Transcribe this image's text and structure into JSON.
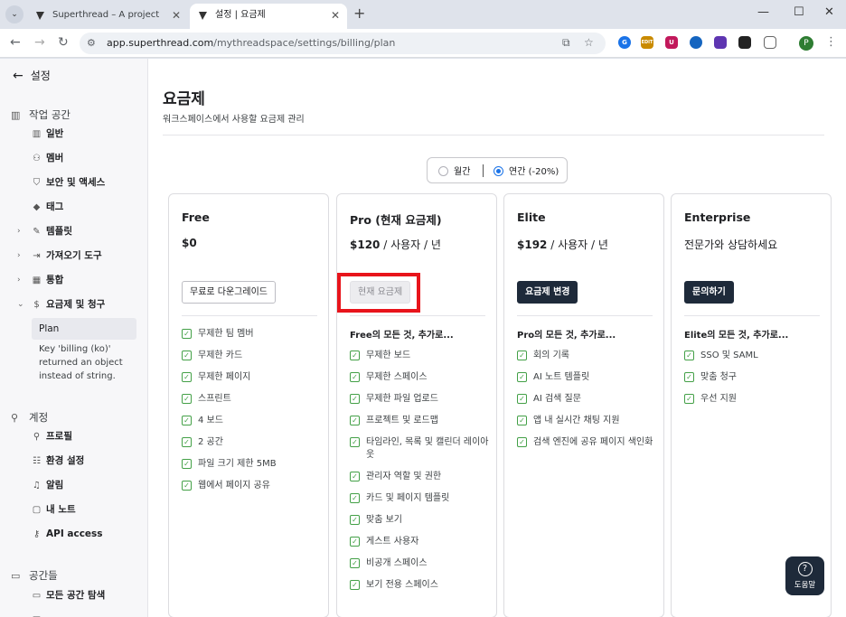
{
  "browser": {
    "tabs": [
      {
        "title": "Superthread – A project mana",
        "active": false
      },
      {
        "title": "설정 | 요금제",
        "active": true
      }
    ],
    "new_tab": "+",
    "url_host": "app.superthread.com",
    "url_path": "/mythreadspace/settings/billing/plan",
    "profile_initial": "P",
    "extensions": [
      {
        "icon": "ext-blue-icon",
        "color": "#1a73e8",
        "label": "G"
      },
      {
        "icon": "ext-orange-icon",
        "color": "#c98a00",
        "label": "EDIT"
      },
      {
        "icon": "ext-ublock-icon",
        "color": "#c2185b",
        "label": "U"
      },
      {
        "icon": "ext-shield-icon",
        "color": "#1565c0",
        "label": ""
      },
      {
        "icon": "ext-purple-icon",
        "color": "#5e35b1",
        "label": ""
      },
      {
        "icon": "ext-dark-icon",
        "color": "#222222",
        "label": ""
      }
    ]
  },
  "sidebar": {
    "back_label": "설정",
    "workspace": {
      "title": "작업 공간",
      "items": [
        {
          "label": "일반",
          "icon": "building-icon"
        },
        {
          "label": "멤버",
          "icon": "users-icon"
        },
        {
          "label": "보안 및 액세스",
          "icon": "shield-icon"
        },
        {
          "label": "태그",
          "icon": "tag-icon"
        },
        {
          "label": "템플릿",
          "icon": "template-icon"
        },
        {
          "label": "가져오기 도구",
          "icon": "import-icon"
        },
        {
          "label": "통합",
          "icon": "grid-icon"
        },
        {
          "label": "요금제 및 청구",
          "icon": "dollar-icon"
        }
      ],
      "active_sub": "Plan",
      "error_message": "Key 'billing (ko)' returned an object instead of string."
    },
    "account": {
      "title": "계정",
      "items": [
        {
          "label": "프로필",
          "icon": "person-icon"
        },
        {
          "label": "환경 설정",
          "icon": "sliders-icon"
        },
        {
          "label": "알림",
          "icon": "bell-icon"
        },
        {
          "label": "내 노트",
          "icon": "note-icon"
        },
        {
          "label": "API access",
          "icon": "key-icon"
        }
      ]
    },
    "spaces": {
      "title": "공간들",
      "items": [
        {
          "label": "모든 공간 탐색",
          "icon": "folder-icon"
        },
        {
          "label": "",
          "icon": "folder-icon"
        }
      ]
    }
  },
  "main": {
    "title": "요금제",
    "subtitle": "워크스페이스에서 사용할 요금제 관리",
    "billing_toggle": {
      "monthly": "월간",
      "yearly": "연간 (-20%)",
      "selected": "yearly"
    },
    "plans": [
      {
        "name": "Free",
        "price": "$0",
        "price_suffix": "",
        "cta": "무료로 다운그레이드",
        "cta_style": "outline",
        "features_heading": "",
        "features": [
          "무제한 팀 멤버",
          "무제한 카드",
          "무제한 페이지",
          "스프린트",
          "4 보드",
          "2 공간",
          "파일 크기 제한 5MB",
          "웹에서 페이지 공유"
        ]
      },
      {
        "name": "Pro (현재 요금제)",
        "price": "$120",
        "price_suffix": " / 사용자 / 년",
        "cta": "현재 요금제",
        "cta_style": "disabled",
        "features_heading": "Free의 모든 것, 추가로...",
        "features": [
          "무제한 보드",
          "무제한 스페이스",
          "무제한 파일 업로드",
          "프로젝트 및 로드맵",
          "타임라인, 목록 및 캘린더 레이아웃",
          "관리자 역할 및 권한",
          "카드 및 페이지 템플릿",
          "맞춤 보기",
          "게스트 사용자",
          "비공개 스페이스",
          "보기 전용 스페이스"
        ]
      },
      {
        "name": "Elite",
        "price": "$192",
        "price_suffix": " / 사용자 / 년",
        "cta": "요금제 변경",
        "cta_style": "dark",
        "features_heading": "Pro의 모든 것, 추가로...",
        "features": [
          "회의 기록",
          "AI 노트 템플릿",
          "AI 검색 질문",
          "앱 내 실시간 채팅 지원",
          "검색 엔진에 공유 페이지 색인화"
        ]
      },
      {
        "name": "Enterprise",
        "price": "",
        "price_suffix": "전문가와 상담하세요",
        "cta": "문의하기",
        "cta_style": "dark",
        "features_heading": "Elite의 모든 것, 추가로...",
        "features": [
          "SSO 및 SAML",
          "맞춤 청구",
          "우선 지원"
        ]
      }
    ],
    "highlight_color": "#e8141b"
  },
  "help": {
    "label": "도움말"
  }
}
